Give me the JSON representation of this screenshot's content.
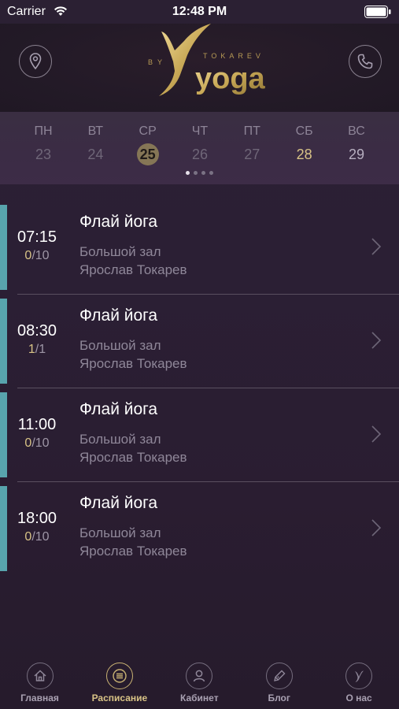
{
  "status_bar": {
    "carrier": "Carrier",
    "time": "12:48 PM"
  },
  "header": {
    "logo": {
      "by": "BY",
      "brand": "TOKAREV",
      "word": "yoga",
      "letter": "Y"
    },
    "location_icon": "location-pin-icon",
    "phone_icon": "phone-icon"
  },
  "week": {
    "days": [
      {
        "name": "ПН",
        "num": "23",
        "state": "past"
      },
      {
        "name": "ВТ",
        "num": "24",
        "state": "past"
      },
      {
        "name": "СР",
        "num": "25",
        "state": "today"
      },
      {
        "name": "ЧТ",
        "num": "26",
        "state": "past"
      },
      {
        "name": "ПТ",
        "num": "27",
        "state": "past"
      },
      {
        "name": "СБ",
        "num": "28",
        "state": "available"
      },
      {
        "name": "ВС",
        "num": "29",
        "state": "normal"
      }
    ],
    "page_dots": 4,
    "active_dot": 0
  },
  "schedule": [
    {
      "time": "07:15",
      "booked": "0",
      "capacity": "10",
      "title": "Флай йога",
      "hall": "Большой зал",
      "teacher": "Ярослав Токарев"
    },
    {
      "time": "08:30",
      "booked": "1",
      "capacity": "1",
      "title": "Флай йога",
      "hall": "Большой зал",
      "teacher": "Ярослав Токарев"
    },
    {
      "time": "11:00",
      "booked": "0",
      "capacity": "10",
      "title": "Флай йога",
      "hall": "Большой зал",
      "teacher": "Ярослав Токарев"
    },
    {
      "time": "18:00",
      "booked": "0",
      "capacity": "10",
      "title": "Флай йога",
      "hall": "Большой зал",
      "teacher": "Ярослав Токарев"
    }
  ],
  "tabbar": {
    "tabs": [
      {
        "label": "Главная",
        "icon": "home-icon"
      },
      {
        "label": "Расписание",
        "icon": "list-icon",
        "active": true
      },
      {
        "label": "Кабинет",
        "icon": "user-icon"
      },
      {
        "label": "Блог",
        "icon": "pen-icon"
      },
      {
        "label": "О нас",
        "icon": "logo-y-icon"
      }
    ]
  },
  "colors": {
    "accent_teal": "#58a4ad",
    "gold": "#d8c386",
    "background": "#2a1e30"
  }
}
